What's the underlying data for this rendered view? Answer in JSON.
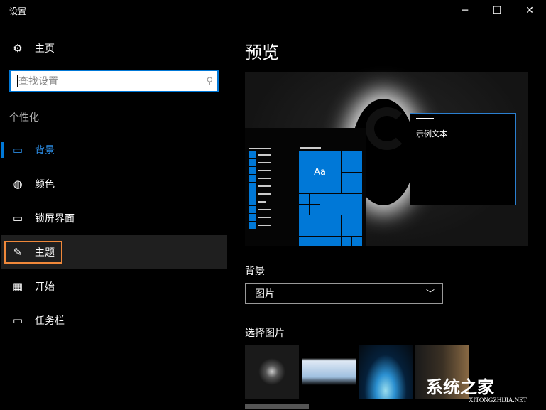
{
  "window": {
    "title": "设置",
    "minimize": "─",
    "maximize": "☐",
    "close": "✕"
  },
  "sidebar": {
    "home": "主页",
    "search_placeholder": "查找设置",
    "section": "个性化",
    "items": [
      {
        "label": "背景",
        "icon": "image-icon",
        "active": true
      },
      {
        "label": "颜色",
        "icon": "palette-icon"
      },
      {
        "label": "锁屏界面",
        "icon": "lock-screen-icon"
      },
      {
        "label": "主题",
        "icon": "theme-icon",
        "highlighted": true
      },
      {
        "label": "开始",
        "icon": "start-icon"
      },
      {
        "label": "任务栏",
        "icon": "taskbar-icon"
      }
    ]
  },
  "main": {
    "heading": "预览",
    "preview": {
      "tile_text": "Aa",
      "sample_text": "示例文本"
    },
    "background_label": "背景",
    "background_value": "图片",
    "choose_label": "选择图片"
  },
  "watermark": {
    "name": "系统之家",
    "url": "XITONGZHIJIA.NET"
  },
  "colors": {
    "accent": "#0078d7",
    "highlight": "#f0883a"
  }
}
